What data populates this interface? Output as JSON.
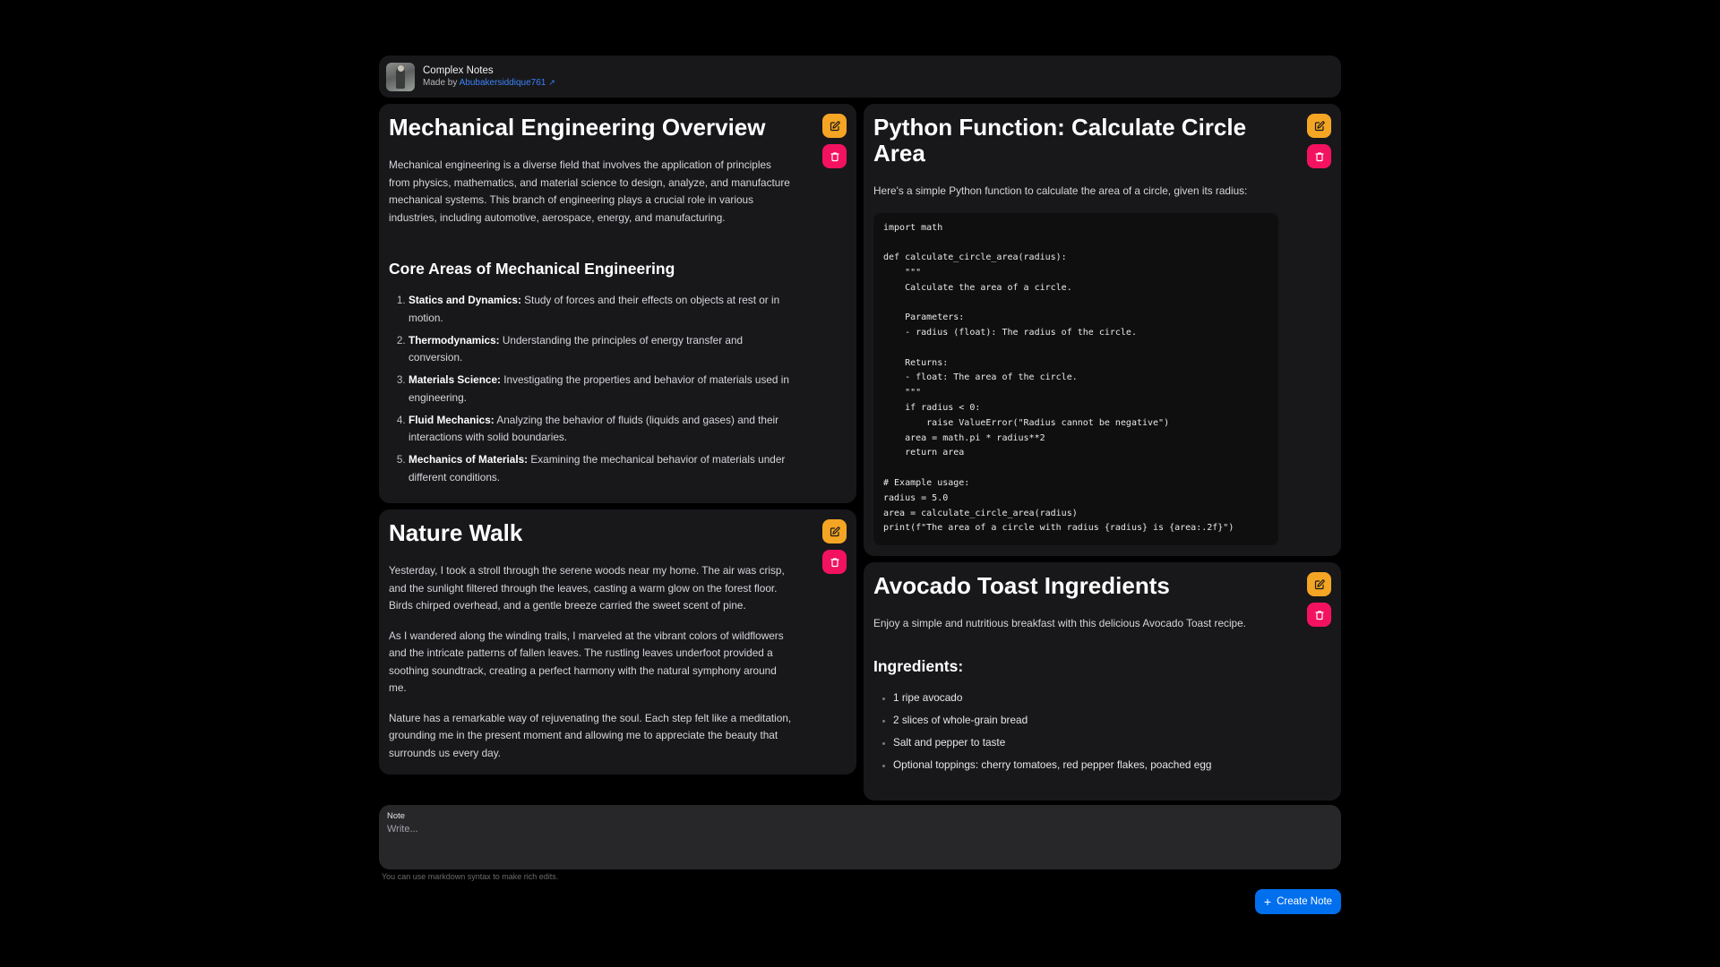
{
  "header": {
    "title": "Complex Notes",
    "made_by_prefix": "Made by ",
    "author": "Abubakersiddique761"
  },
  "notes": {
    "mech": {
      "title": "Mechanical Engineering Overview",
      "intro": "Mechanical engineering is a diverse field that involves the application of principles from physics, mathematics, and material science to design, analyze, and manufacture mechanical systems. This branch of engineering plays a crucial role in various industries, including automotive, aerospace, energy, and manufacturing.",
      "subheading": "Core Areas of Mechanical Engineering",
      "items": [
        {
          "term": "Statics and Dynamics:",
          "desc": " Study of forces and their effects on objects at rest or in motion."
        },
        {
          "term": "Thermodynamics:",
          "desc": " Understanding the principles of energy transfer and conversion."
        },
        {
          "term": "Materials Science:",
          "desc": " Investigating the properties and behavior of materials used in engineering."
        },
        {
          "term": "Fluid Mechanics:",
          "desc": " Analyzing the behavior of fluids (liquids and gases) and their interactions with solid boundaries."
        },
        {
          "term": "Mechanics of Materials:",
          "desc": " Examining the mechanical behavior of materials under different conditions."
        }
      ]
    },
    "nature": {
      "title": "Nature Walk",
      "paragraphs": [
        "Yesterday, I took a stroll through the serene woods near my home. The air was crisp, and the sunlight filtered through the leaves, casting a warm glow on the forest floor. Birds chirped overhead, and a gentle breeze carried the sweet scent of pine.",
        "As I wandered along the winding trails, I marveled at the vibrant colors of wildflowers and the intricate patterns of fallen leaves. The rustling leaves underfoot provided a soothing soundtrack, creating a perfect harmony with the natural symphony around me.",
        "Nature has a remarkable way of rejuvenating the soul. Each step felt like a meditation, grounding me in the present moment and allowing me to appreciate the beauty that surrounds us every day."
      ]
    },
    "python": {
      "title": "Python Function: Calculate Circle Area",
      "intro": "Here's a simple Python function to calculate the area of a circle, given its radius:",
      "code": "import math\n\ndef calculate_circle_area(radius):\n    \"\"\"\n    Calculate the area of a circle.\n\n    Parameters:\n    - radius (float): The radius of the circle.\n\n    Returns:\n    - float: The area of the circle.\n    \"\"\"\n    if radius < 0:\n        raise ValueError(\"Radius cannot be negative\")\n    area = math.pi * radius**2\n    return area\n\n# Example usage:\nradius = 5.0\narea = calculate_circle_area(radius)\nprint(f\"The area of a circle with radius {radius} is {area:.2f}\")"
    },
    "avocado": {
      "title": "Avocado Toast Ingredients",
      "intro": "Enjoy a simple and nutritious breakfast with this delicious Avocado Toast recipe.",
      "subheading": "Ingredients:",
      "items": [
        "1 ripe avocado",
        "2 slices of whole-grain bread",
        "Salt and pepper to taste",
        "Optional toppings: cherry tomatoes, red pepper flakes, poached egg"
      ]
    }
  },
  "composer": {
    "label": "Note",
    "placeholder": "Write...",
    "hint": "You can use markdown syntax to make rich edits.",
    "create_label": "Create Note"
  },
  "icons": {
    "edit": "edit-icon",
    "delete": "trash-icon",
    "external": "external-link-icon",
    "plus": "plus-icon"
  },
  "colors": {
    "edit_button": "#f5a524",
    "delete_button": "#f31260",
    "primary_button": "#006fee",
    "link": "#3b82f6"
  }
}
